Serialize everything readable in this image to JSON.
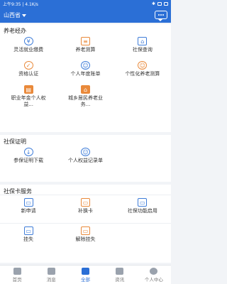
{
  "status": {
    "left": "上午9:35 | 4.1K/s",
    "right_icons": [
      "bluetooth-icon",
      "wifi-icon",
      "battery-icon"
    ]
  },
  "header": {
    "region": "山西省"
  },
  "pension": {
    "title": "养老经办",
    "items": [
      {
        "label": "灵活就业缴费",
        "icon": "flex-pay-icon"
      },
      {
        "label": "养老测算",
        "icon": "calc-icon"
      },
      {
        "label": "社保查询",
        "icon": "insure-query-icon"
      },
      {
        "label": "资格认证",
        "icon": "qualify-icon"
      },
      {
        "label": "个人年度账单",
        "icon": "bill-icon"
      },
      {
        "label": "个性化养老测算",
        "icon": "custom-calc-icon"
      },
      {
        "label": "职业年金个人权益...",
        "icon": "annuity-icon"
      },
      {
        "label": "城乡居民养老业务...",
        "icon": "resident-icon"
      }
    ]
  },
  "proof": {
    "title": "社保证明",
    "items": [
      {
        "label": "参保证明下载",
        "icon": "download-icon"
      },
      {
        "label": "个人权益记录单",
        "icon": "record-icon"
      }
    ]
  },
  "card": {
    "title": "社保卡服务",
    "items": [
      {
        "label": "新申请",
        "icon": "new-card-icon"
      },
      {
        "label": "补换卡",
        "icon": "replace-card-icon"
      },
      {
        "label": "社保功能启用",
        "icon": "enable-icon"
      },
      {
        "label": "挂失",
        "icon": "report-loss-icon"
      },
      {
        "label": "解除挂失",
        "icon": "cancel-loss-icon"
      }
    ]
  },
  "tabs": [
    {
      "label": "首页",
      "icon": "home-icon",
      "active": false
    },
    {
      "label": "消息",
      "icon": "message-icon",
      "active": false
    },
    {
      "label": "全部",
      "icon": "grid-icon",
      "active": true
    },
    {
      "label": "资讯",
      "icon": "news-icon",
      "active": false
    },
    {
      "label": "个人中心",
      "icon": "user-icon",
      "active": false
    }
  ],
  "colors": {
    "primary": "#2b6fd6",
    "orange": "#e9893a",
    "bg": "#f2f4f7"
  }
}
